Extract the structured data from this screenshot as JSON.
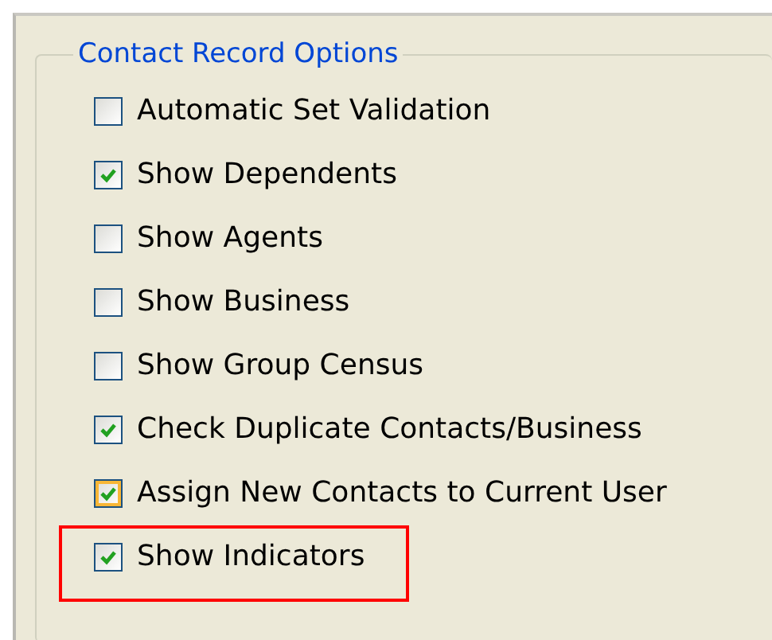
{
  "group": {
    "title": "Contact Record Options"
  },
  "options": [
    {
      "label": "Automatic Set Validation",
      "checked": false,
      "hovered": false,
      "highlighted": false
    },
    {
      "label": "Show Dependents",
      "checked": true,
      "hovered": false,
      "highlighted": false
    },
    {
      "label": "Show Agents",
      "checked": false,
      "hovered": false,
      "highlighted": false
    },
    {
      "label": "Show Business",
      "checked": false,
      "hovered": false,
      "highlighted": false
    },
    {
      "label": "Show Group Census",
      "checked": false,
      "hovered": false,
      "highlighted": false
    },
    {
      "label": "Check Duplicate Contacts/Business",
      "checked": true,
      "hovered": false,
      "highlighted": false
    },
    {
      "label": "Assign New Contacts to Current User",
      "checked": true,
      "hovered": true,
      "highlighted": false
    },
    {
      "label": "Show Indicators",
      "checked": true,
      "hovered": false,
      "highlighted": true
    }
  ]
}
